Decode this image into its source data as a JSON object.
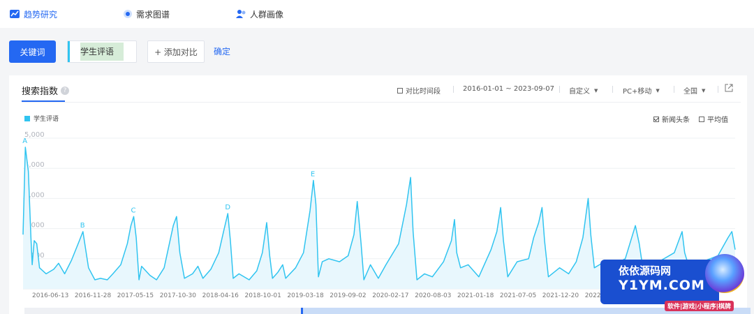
{
  "nav": {
    "items": [
      {
        "label": "趋势研究",
        "icon": "trend-chart-icon",
        "active": true
      },
      {
        "label": "需求图谱",
        "icon": "radar-icon",
        "active": false
      },
      {
        "label": "人群画像",
        "icon": "people-icon",
        "active": false
      }
    ]
  },
  "query": {
    "keyword_button": "关键词",
    "keyword": "学生评语",
    "add_compare": "+ 添加对比",
    "confirm": "确定"
  },
  "panel": {
    "title": "搜索指数",
    "compare_period": "对比时间段",
    "date_range": "2016-01-01 ~ 2023-09-07",
    "range_mode": "自定义",
    "device": "PC+移动",
    "region": "全国",
    "news_toggle": "新闻头条",
    "avg_toggle": "平均值"
  },
  "colors": {
    "accent": "#2468f2",
    "series": "#30c4f0"
  },
  "chart_data": {
    "type": "area",
    "series": [
      {
        "name": "学生评语",
        "points": [
          [
            "2016-01-01",
            1800
          ],
          [
            "2016-01-10",
            4700
          ],
          [
            "2016-01-22",
            3900
          ],
          [
            "2016-02-01",
            1700
          ],
          [
            "2016-02-06",
            800
          ],
          [
            "2016-02-14",
            1600
          ],
          [
            "2016-02-24",
            1500
          ],
          [
            "2016-03-06",
            700
          ],
          [
            "2016-04-01",
            500
          ],
          [
            "2016-05-01",
            650
          ],
          [
            "2016-05-20",
            850
          ],
          [
            "2016-06-13",
            500
          ],
          [
            "2016-07-10",
            950
          ],
          [
            "2016-08-10",
            1600
          ],
          [
            "2016-08-24",
            1900
          ],
          [
            "2016-09-02",
            1400
          ],
          [
            "2016-09-15",
            700
          ],
          [
            "2016-10-10",
            300
          ],
          [
            "2016-11-01",
            350
          ],
          [
            "2016-11-28",
            300
          ],
          [
            "2016-12-20",
            500
          ],
          [
            "2017-01-20",
            800
          ],
          [
            "2017-02-15",
            1500
          ],
          [
            "2017-03-01",
            2100
          ],
          [
            "2017-03-12",
            2400
          ],
          [
            "2017-03-22",
            1700
          ],
          [
            "2017-04-02",
            300
          ],
          [
            "2017-04-12",
            750
          ],
          [
            "2017-05-15",
            450
          ],
          [
            "2017-06-10",
            300
          ],
          [
            "2017-07-10",
            700
          ],
          [
            "2017-08-15",
            2100
          ],
          [
            "2017-08-28",
            2400
          ],
          [
            "2017-09-10",
            1200
          ],
          [
            "2017-09-28",
            350
          ],
          [
            "2017-10-30",
            500
          ],
          [
            "2017-11-20",
            750
          ],
          [
            "2017-12-10",
            350
          ],
          [
            "2018-01-10",
            650
          ],
          [
            "2018-02-10",
            1200
          ],
          [
            "2018-03-01",
            1900
          ],
          [
            "2018-03-18",
            2500
          ],
          [
            "2018-03-28",
            1600
          ],
          [
            "2018-04-08",
            350
          ],
          [
            "2018-05-01",
            500
          ],
          [
            "2018-06-10",
            300
          ],
          [
            "2018-07-10",
            600
          ],
          [
            "2018-08-01",
            1200
          ],
          [
            "2018-08-18",
            2200
          ],
          [
            "2018-08-30",
            1100
          ],
          [
            "2018-09-10",
            350
          ],
          [
            "2018-10-01",
            550
          ],
          [
            "2018-10-20",
            800
          ],
          [
            "2018-11-01",
            350
          ],
          [
            "2018-12-10",
            700
          ],
          [
            "2019-01-10",
            1200
          ],
          [
            "2019-02-05",
            2600
          ],
          [
            "2019-02-18",
            3600
          ],
          [
            "2019-02-28",
            2800
          ],
          [
            "2019-03-10",
            400
          ],
          [
            "2019-03-25",
            900
          ],
          [
            "2019-04-20",
            1000
          ],
          [
            "2019-06-01",
            900
          ],
          [
            "2019-07-05",
            1100
          ],
          [
            "2019-07-28",
            1800
          ],
          [
            "2019-08-10",
            2900
          ],
          [
            "2019-08-25",
            1500
          ],
          [
            "2019-09-05",
            300
          ],
          [
            "2019-10-01",
            800
          ],
          [
            "2019-11-01",
            350
          ],
          [
            "2019-12-01",
            800
          ],
          [
            "2020-01-20",
            1500
          ],
          [
            "2020-02-20",
            2800
          ],
          [
            "2020-03-07",
            3700
          ],
          [
            "2020-03-17",
            1900
          ],
          [
            "2020-04-01",
            300
          ],
          [
            "2020-05-01",
            500
          ],
          [
            "2020-06-01",
            400
          ],
          [
            "2020-07-15",
            900
          ],
          [
            "2020-08-15",
            1600
          ],
          [
            "2020-08-27",
            2300
          ],
          [
            "2020-09-05",
            1200
          ],
          [
            "2020-09-20",
            700
          ],
          [
            "2020-10-20",
            800
          ],
          [
            "2020-12-01",
            400
          ],
          [
            "2021-01-18",
            1300
          ],
          [
            "2021-02-10",
            1900
          ],
          [
            "2021-02-25",
            2700
          ],
          [
            "2021-03-08",
            1600
          ],
          [
            "2021-03-25",
            400
          ],
          [
            "2021-05-01",
            900
          ],
          [
            "2021-06-15",
            1000
          ],
          [
            "2021-07-05",
            1700
          ],
          [
            "2021-07-25",
            2200
          ],
          [
            "2021-08-07",
            2700
          ],
          [
            "2021-08-17",
            1600
          ],
          [
            "2021-09-01",
            400
          ],
          [
            "2021-10-15",
            700
          ],
          [
            "2021-11-20",
            500
          ],
          [
            "2021-12-20",
            900
          ],
          [
            "2022-01-15",
            1700
          ],
          [
            "2022-02-05",
            3000
          ],
          [
            "2022-02-15",
            1800
          ],
          [
            "2022-03-01",
            700
          ],
          [
            "2022-04-10",
            900
          ],
          [
            "2022-05-20",
            800
          ],
          [
            "2022-07-01",
            1000
          ],
          [
            "2022-08-10",
            2100
          ],
          [
            "2022-08-25",
            1500
          ],
          [
            "2022-09-10",
            600
          ],
          [
            "2022-11-10",
            900
          ],
          [
            "2023-01-10",
            1200
          ],
          [
            "2023-02-10",
            1900
          ],
          [
            "2023-02-20",
            1200
          ],
          [
            "2023-03-10",
            700
          ],
          [
            "2023-05-01",
            900
          ],
          [
            "2023-07-01",
            1100
          ],
          [
            "2023-08-10",
            1700
          ],
          [
            "2023-08-25",
            1900
          ],
          [
            "2023-09-07",
            1300
          ]
        ]
      }
    ],
    "ylim": [
      0,
      5000
    ],
    "yticks": [
      "5,000",
      "4,000",
      "3,000",
      "2,000",
      "1,000"
    ],
    "xticks": [
      "2016-06-13",
      "2016-11-28",
      "2017-05-15",
      "2017-10-30",
      "2018-04-16",
      "2018-10-01",
      "2019-03-18",
      "2019-09-02",
      "2020-02-17",
      "2020-08-03",
      "2021-01-18",
      "2021-07-05",
      "2021-12-20",
      "2022"
    ],
    "annotations": [
      {
        "label": "A",
        "date": "2016-01-10",
        "value": 4700
      },
      {
        "label": "B",
        "date": "2016-08-24",
        "value": 1900
      },
      {
        "label": "C",
        "date": "2017-03-12",
        "value": 2400
      },
      {
        "label": "D",
        "date": "2018-03-18",
        "value": 2500
      },
      {
        "label": "E",
        "date": "2019-02-18",
        "value": 3600
      }
    ],
    "grid": true,
    "legend": "top-left"
  },
  "watermark": {
    "line1": "依依源码网",
    "line2": "Y1YM.COM",
    "line3": "软件|游戏|小程序|棋牌"
  }
}
